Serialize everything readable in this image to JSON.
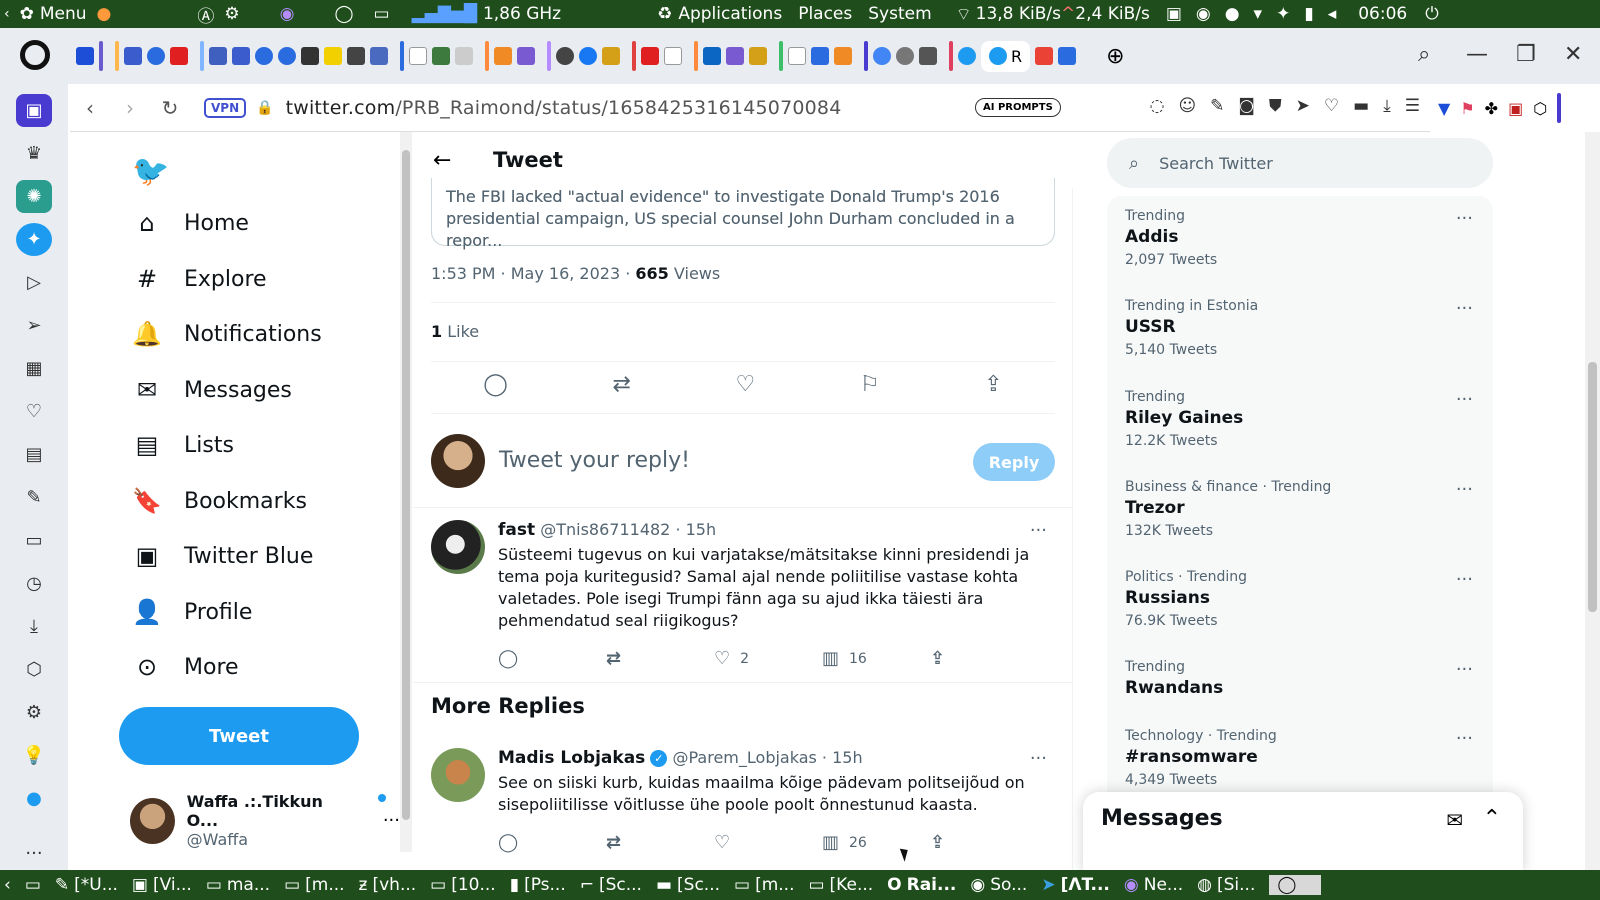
{
  "system_bar": {
    "menu_label": "Menu",
    "cpu": "1,86 GHz",
    "applications": "Applications",
    "places": "Places",
    "system": "System",
    "net_down": "13,8 KiB/s",
    "net_up": "2,4 KiB/s",
    "clock": "06:06"
  },
  "browser": {
    "vpn_label": "VPN",
    "url_host": "twitter.com",
    "url_path": "/PRB_Raimond/status/1658425316145070084",
    "ai_prompts_label": "AI PROMPTS",
    "active_tab_letter": "R"
  },
  "nav": {
    "items": [
      {
        "label": "Home",
        "icon": "home-icon"
      },
      {
        "label": "Explore",
        "icon": "hashtag-icon"
      },
      {
        "label": "Notifications",
        "icon": "bell-icon"
      },
      {
        "label": "Messages",
        "icon": "envelope-icon"
      },
      {
        "label": "Lists",
        "icon": "list-icon"
      },
      {
        "label": "Bookmarks",
        "icon": "bookmark-icon"
      },
      {
        "label": "Twitter Blue",
        "icon": "twitter-blue-icon"
      },
      {
        "label": "Profile",
        "icon": "person-icon"
      },
      {
        "label": "More",
        "icon": "more-circle-icon"
      }
    ],
    "tweet_button": "Tweet",
    "account": {
      "name": "Waffa .:.Tikkun O...",
      "handle": "@Waffa"
    }
  },
  "tweet": {
    "header_title": "Tweet",
    "card_text_line1": "The FBI lacked \"actual evidence\" to investigate Donald Trump's 2016",
    "card_text_line2": "presidential campaign, US special counsel John Durham concluded in a repor...",
    "time": "1:53 PM · May 16, 2023 · ",
    "views_count": "665",
    "views_label": " Views",
    "likes_count": "1",
    "likes_label": " Like",
    "reply_placeholder": "Tweet your reply!",
    "reply_button": "Reply"
  },
  "replies": [
    {
      "name": "fast",
      "handle": "@Tnis86711482 · 15h",
      "text": "Süsteemi tugevus on kui varjatakse/mätsitakse kinni presidendi ja tema poja kuritegusid? Samal ajal nende poliitilise vastase kohta valetades. Pole isegi Trumpi fänn aga su ajud ikka täiesti ära pehmendatud seal riigikogus?",
      "likes": "2",
      "views": "16"
    }
  ],
  "more_replies_title": "More Replies",
  "more_replies": [
    {
      "name": "Madis Lobjakas",
      "handle": "@Parem_Lobjakas · 15h",
      "text": "See on siiski kurb, kuidas maailma kõige pädevam politseijõud on sisepoliitilisse võitlusse ühe poole poolt õnnestunud kaasta.",
      "views": "26"
    }
  ],
  "search_placeholder": "Search Twitter",
  "trends": [
    {
      "category": "Trending",
      "name": "Addis",
      "count": "2,097 Tweets"
    },
    {
      "category": "Trending in Estonia",
      "name": "USSR",
      "count": "5,140 Tweets"
    },
    {
      "category": "Trending",
      "name": "Riley Gaines",
      "count": "12.2K Tweets"
    },
    {
      "category": "Business & finance · Trending",
      "name": "Trezor",
      "count": "132K Tweets"
    },
    {
      "category": "Politics · Trending",
      "name": "Russians",
      "count": "76.9K Tweets"
    },
    {
      "category": "Trending",
      "name": "Rwandans",
      "count": ""
    },
    {
      "category": "Technology · Trending",
      "name": "#ransomware",
      "count": "4,349 Tweets"
    }
  ],
  "messages_dock_title": "Messages",
  "taskbar": [
    "[*U...",
    "[Vi...",
    "ma...",
    "[m...",
    "[vh...",
    "[10...",
    "[Ps...",
    "[Sc...",
    "[Sc...",
    "[m...",
    "[Ke...",
    "Rai...",
    "So...",
    "[ΛT...",
    "Ne...",
    "[Si..."
  ],
  "colors": {
    "twitter_blue": "#1d9bf0",
    "system_bar": "#1f4e1c"
  }
}
